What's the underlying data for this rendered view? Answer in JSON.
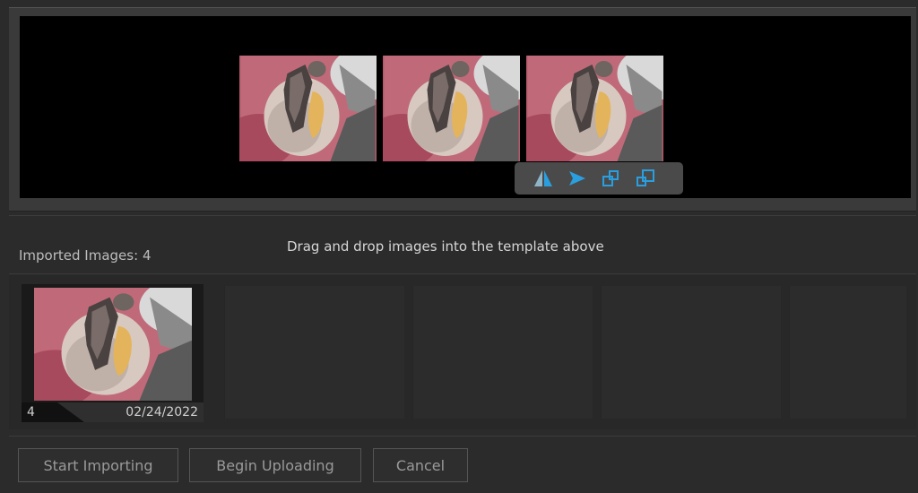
{
  "template": {
    "images": [
      {
        "icon": "tooth-photo"
      },
      {
        "icon": "tooth-photo"
      },
      {
        "icon": "tooth-photo"
      }
    ],
    "tools": [
      {
        "icon": "flip-horizontal-icon"
      },
      {
        "icon": "rotate-icon"
      },
      {
        "icon": "shrink-icon"
      },
      {
        "icon": "enlarge-icon"
      }
    ],
    "accent_color": "#2a9fe0"
  },
  "hint": {
    "text": "Drag and drop images into the template above"
  },
  "imported": {
    "label": "Imported Images:",
    "count": "4"
  },
  "thumbnail": {
    "number": "4",
    "date": "02/24/2022"
  },
  "buttons": {
    "start_importing": "Start Importing",
    "begin_uploading": "Begin Uploading",
    "cancel": "Cancel"
  }
}
